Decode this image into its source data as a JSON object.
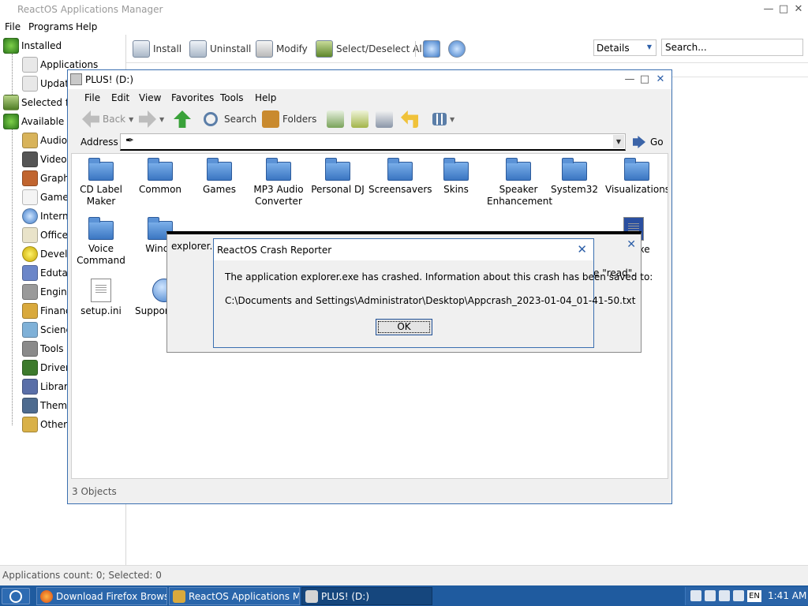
{
  "apps_manager": {
    "title": "ReactOS Applications Manager",
    "menu": [
      "File",
      "Programs",
      "Help"
    ],
    "tree": {
      "installed": "Installed",
      "installed_children": [
        "Applications",
        "Updates"
      ],
      "selected": "Selected for",
      "available": "Available for",
      "categories": [
        "Audio",
        "Video",
        "Graphics",
        "Games",
        "Internet",
        "Office",
        "Development",
        "Edutainment",
        "Engineering",
        "Finance",
        "Science",
        "Tools",
        "Drivers",
        "Libraries",
        "Themes",
        "Other"
      ]
    },
    "toolbar": {
      "install": "Install",
      "uninstall": "Uninstall",
      "modify": "Modify",
      "select_all": "Select/Deselect All"
    },
    "view_mode": "Details",
    "search_placeholder": "Search...",
    "status": "Applications count: 0; Selected: 0"
  },
  "explorer": {
    "title": "PLUS! (D:)",
    "menu": [
      "File",
      "Edit",
      "View",
      "Favorites",
      "Tools",
      "Help"
    ],
    "toolbar": {
      "back": "Back",
      "search": "Search",
      "folders": "Folders"
    },
    "address_label": "Address",
    "address_value": "",
    "go_label": "Go",
    "folders": [
      "CD Label Maker",
      "Common",
      "Games",
      "MP3 Audio Converter",
      "Personal DJ",
      "Screensavers",
      "Skins",
      "Speaker Enhancement",
      "System32",
      "Visualizations",
      "Voice Command",
      "Windo"
    ],
    "files": [
      "setup.ini",
      "Support"
    ],
    "partial_label": "exe",
    "status": "3 Objects"
  },
  "error_dialog": {
    "title": "explorer.e",
    "message_tail": "e \"read\"."
  },
  "crash_reporter": {
    "title": "ReactOS Crash Reporter",
    "line1": "The application explorer.exe has crashed. Information about this crash has been saved to:",
    "line2": "C:\\Documents and Settings\\Administrator\\Desktop\\Appcrash_2023-01-04_01-41-50.txt",
    "ok": "OK"
  },
  "taskbar": {
    "tasks": [
      "Download Firefox Browse...",
      "ReactOS Applications Ma...",
      "PLUS! (D:)"
    ],
    "lang": "EN",
    "clock": "1:41 AM"
  },
  "colors": {
    "taskbar": "#1f5b9f",
    "window_border": "#3a6fb0",
    "folder": "#3b76c2"
  }
}
